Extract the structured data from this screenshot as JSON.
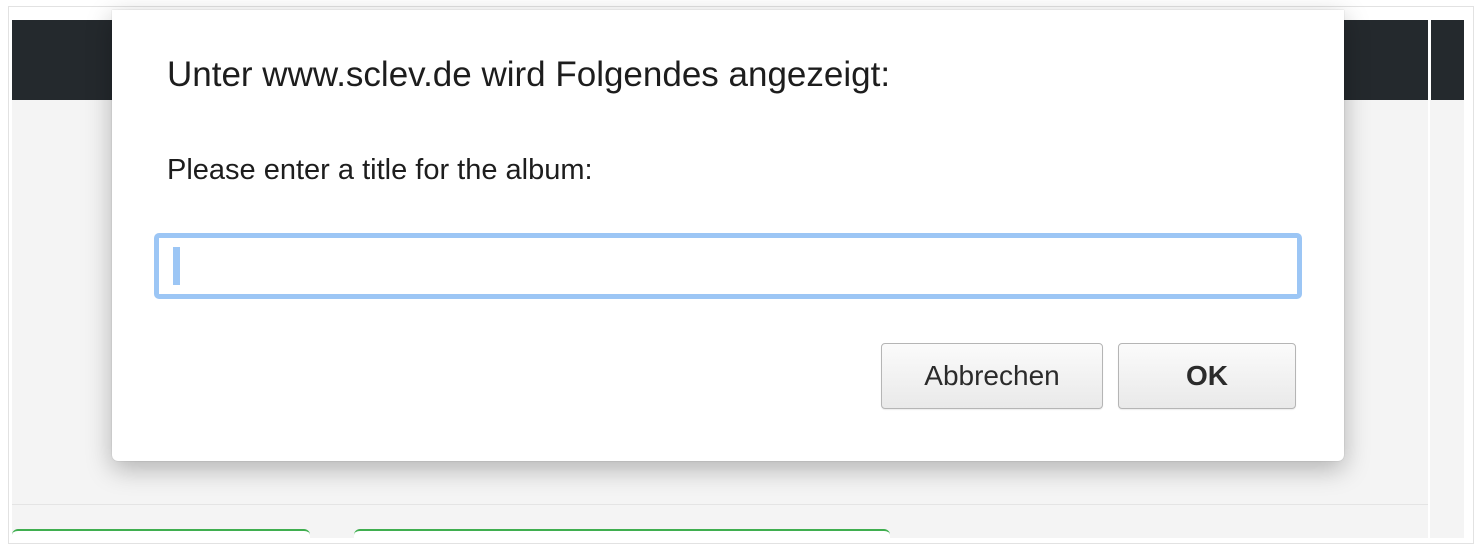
{
  "dialog": {
    "title": "Unter www.sclev.de wird Folgendes angezeigt:",
    "message": "Please enter a title for the album:",
    "input_value": "",
    "cancel_label": "Abbrechen",
    "ok_label": "OK"
  },
  "colors": {
    "header_bar": "#24292d",
    "focus_ring": "#9cc6f5",
    "tab_accent": "#3fae4f"
  }
}
